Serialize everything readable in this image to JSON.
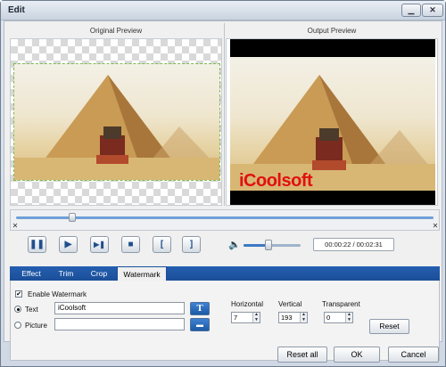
{
  "window": {
    "title": "Edit",
    "minimize_glyph": "▁",
    "close_glyph": "✕"
  },
  "preview": {
    "original_label": "Original Preview",
    "output_label": "Output Preview",
    "watermark_overlay_text": "iCoolsoft"
  },
  "timeline": {
    "progress": 0.135,
    "left_marker_glyph": "✕",
    "right_marker_glyph": "✕"
  },
  "player": {
    "buttons": [
      {
        "name": "pause-button",
        "glyph": "❚❚"
      },
      {
        "name": "play-button",
        "glyph": "▶"
      },
      {
        "name": "next-frame-button",
        "glyph": "▶❚"
      },
      {
        "name": "stop-button",
        "glyph": "■"
      },
      {
        "name": "mark-start-button",
        "glyph": "["
      },
      {
        "name": "mark-end-button",
        "glyph": "]"
      }
    ],
    "volume_glyph": "🔈",
    "volume_level": 0.42,
    "time_display": "00:00:22 / 00:02:31"
  },
  "tabs": [
    {
      "label": "Effect",
      "active": false
    },
    {
      "label": "Trim",
      "active": false
    },
    {
      "label": "Crop",
      "active": false
    },
    {
      "label": "Watermark",
      "active": true
    }
  ],
  "watermark": {
    "enable_label": "Enable Watermark",
    "enabled": true,
    "text_label": "Text",
    "text_value": "iCoolsoft",
    "text_selected": true,
    "picture_label": "Picture",
    "picture_value": "",
    "font_button_glyph": "T",
    "folder_button_glyph": "▬",
    "horizontal_label": "Horizontal",
    "horizontal_value": "7",
    "vertical_label": "Vertical",
    "vertical_value": "193",
    "transparent_label": "Transparent",
    "transparent_value": "0",
    "reset_label": "Reset"
  },
  "footer": {
    "reset_all_label": "Reset all",
    "ok_label": "OK",
    "cancel_label": "Cancel"
  },
  "colors": {
    "tab_bar": "#1b4e98",
    "watermark_text": "#e11010",
    "progress_track": "#6fa0d8"
  }
}
